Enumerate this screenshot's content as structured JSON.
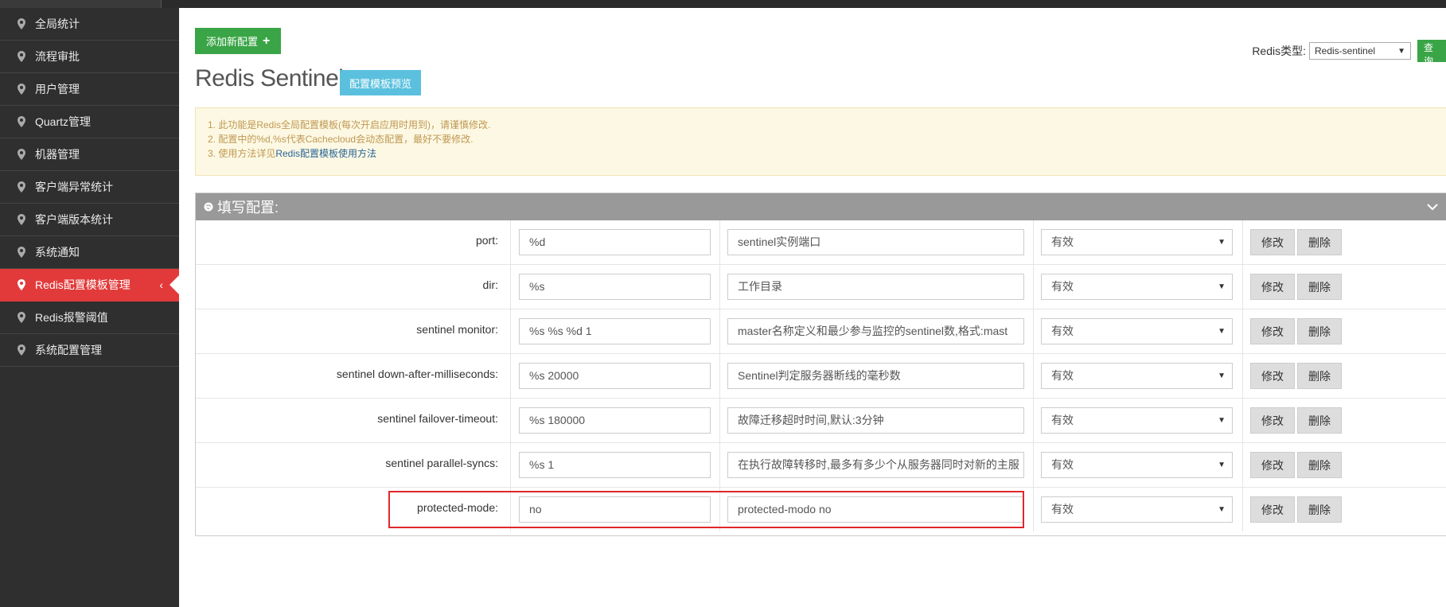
{
  "sidebar": {
    "items": [
      {
        "label": "全局统计",
        "active": false
      },
      {
        "label": "流程审批",
        "active": false
      },
      {
        "label": "用户管理",
        "active": false
      },
      {
        "label": "Quartz管理",
        "active": false
      },
      {
        "label": "机器管理",
        "active": false
      },
      {
        "label": "客户端异常统计",
        "active": false
      },
      {
        "label": "客户端版本统计",
        "active": false
      },
      {
        "label": "系统通知",
        "active": false
      },
      {
        "label": "Redis配置模板管理",
        "active": true
      },
      {
        "label": "Redis报警阈值",
        "active": false
      },
      {
        "label": "系统配置管理",
        "active": false
      }
    ],
    "active_chevron": "‹"
  },
  "toolbar": {
    "add_label": "添加新配置",
    "add_icon": "+",
    "type_label": "Redis类型:",
    "type_value": "Redis-sentinel",
    "query_label": "查询"
  },
  "page": {
    "title": "Redis Sentinel",
    "preview_label": "配置模板预览"
  },
  "notice": {
    "line1": "1. 此功能是Redis全局配置模板(每次开启应用时用到)，请谨慎修改.",
    "line2": "2. 配置中的%d,%s代表Cachecloud会动态配置，最好不要修改.",
    "line3_prefix": "3. 使用方法详见",
    "line3_link": "Redis配置模板使用方法"
  },
  "panel": {
    "title": "填写配置:",
    "modify_label": "修改",
    "delete_label": "删除",
    "rows": [
      {
        "key": "port:",
        "value": "%d",
        "desc": "sentinel实例端口",
        "status": "有效"
      },
      {
        "key": "dir:",
        "value": "%s",
        "desc": "工作目录",
        "status": "有效"
      },
      {
        "key": "sentinel monitor:",
        "value": "%s %s %d 1",
        "desc": "master名称定义和最少参与监控的sentinel数,格式:mast",
        "status": "有效"
      },
      {
        "key": "sentinel down-after-milliseconds:",
        "value": "%s 20000",
        "desc": "Sentinel判定服务器断线的毫秒数",
        "status": "有效"
      },
      {
        "key": "sentinel failover-timeout:",
        "value": "%s 180000",
        "desc": "故障迁移超时时间,默认:3分钟",
        "status": "有效"
      },
      {
        "key": "sentinel parallel-syncs:",
        "value": "%s 1",
        "desc": "在执行故障转移时,最多有多少个从服务器同时对新的主服",
        "status": "有效"
      },
      {
        "key": "protected-mode:",
        "value": "no",
        "desc": "protected-modo no",
        "status": "有效"
      }
    ]
  },
  "colors": {
    "sidebar_bg": "#2f2f2f",
    "active_item": "#e23a3a",
    "add_button": "#39a546",
    "preview_button": "#5bc0de",
    "highlight_box": "#e0272d"
  }
}
